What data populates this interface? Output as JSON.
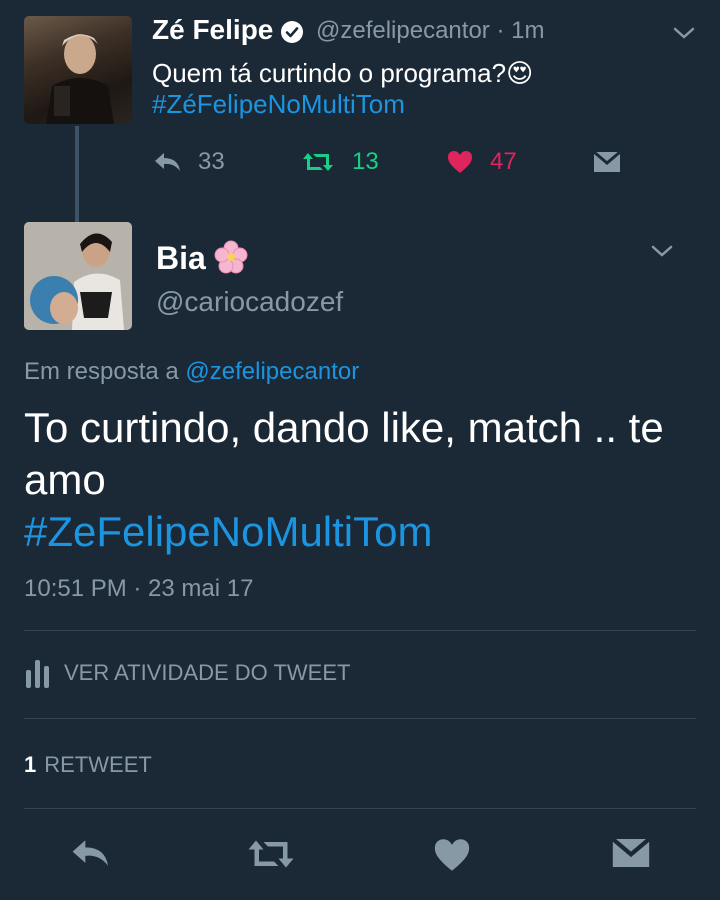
{
  "parent_tweet": {
    "name": "Zé Felipe",
    "handle": "@zefelipecantor",
    "time_separator": "·",
    "time": "1m",
    "text": "Quem tá curtindo o programa?",
    "emoji": "😍",
    "hashtag": "#ZéFelipeNoMultiTom",
    "actions": {
      "reply_count": "33",
      "retweet_count": "13",
      "like_count": "47"
    }
  },
  "reply_tweet": {
    "name": "Bia",
    "name_emoji": "🌸",
    "handle": "@cariocadozef",
    "in_reply_prefix": "Em resposta a",
    "in_reply_mention": "@zefelipecantor",
    "text": "To curtindo, dando like, match .. te amo",
    "hashtag": "#ZeFelipeNoMultiTom",
    "timestamp": "10:51 PM · 23 mai 17"
  },
  "analytics_label": "VER ATIVIDADE DO TWEET",
  "retweet_stat": {
    "count": "1",
    "label": "RETWEET"
  },
  "colors": {
    "background": "#1b2836",
    "link": "#1b95e0",
    "muted": "#8899a6",
    "retweet": "#19cf86",
    "like": "#e0245e"
  }
}
